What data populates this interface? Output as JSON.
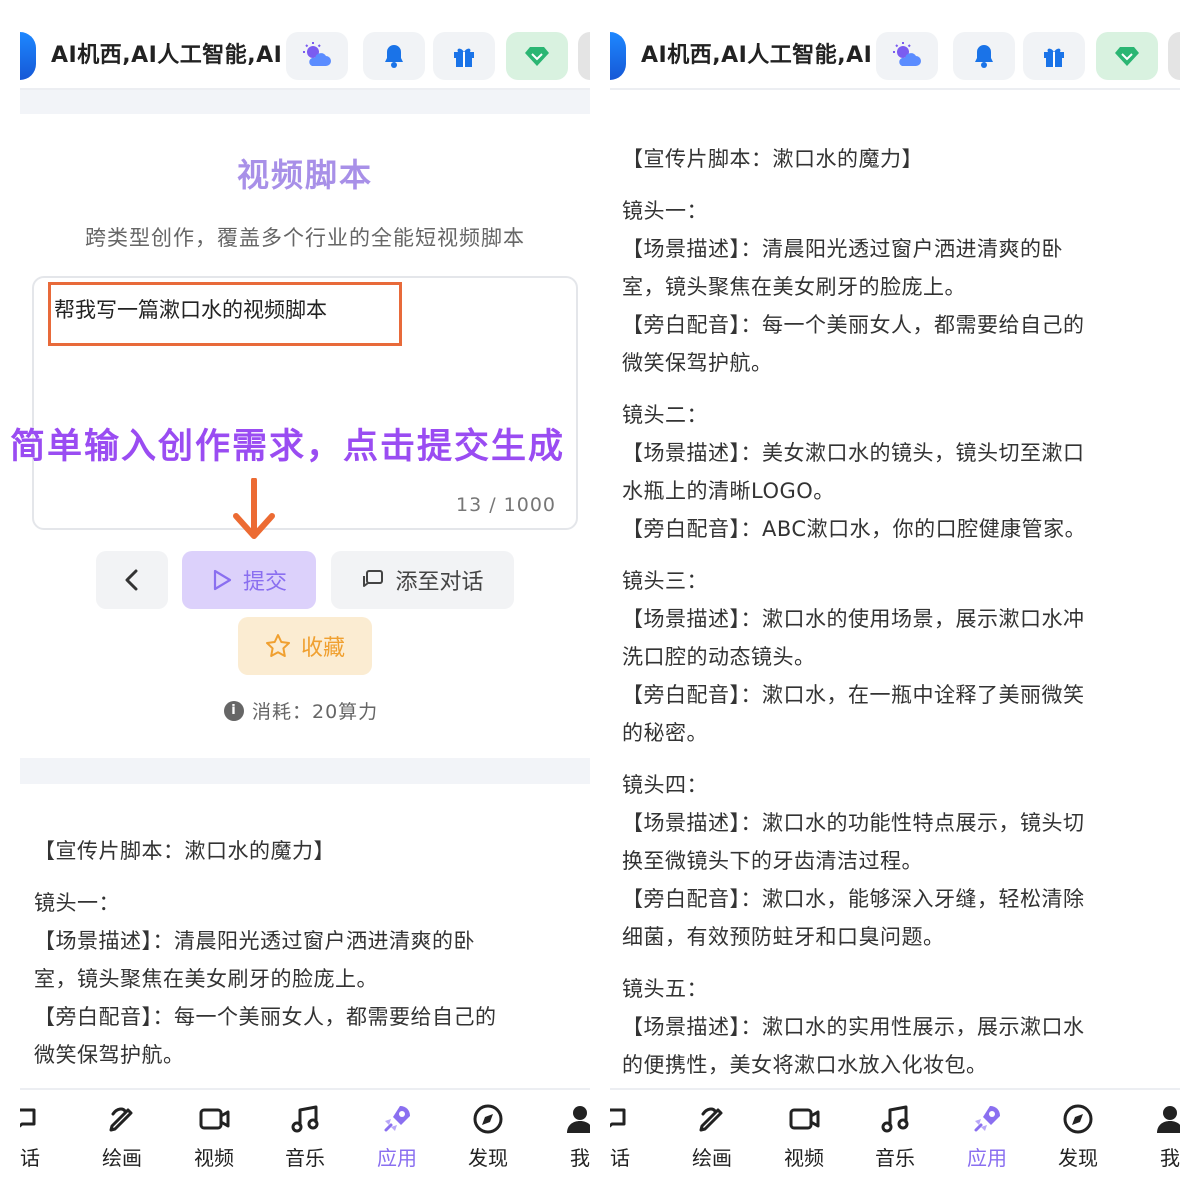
{
  "header": {
    "app_title": "AI机西,AI人工智能,AI",
    "icons": [
      "weather-icon",
      "bell-icon",
      "gift-icon",
      "diamond-vip-icon"
    ]
  },
  "form": {
    "title": "视频脚本",
    "subtitle": "跨类型创作，覆盖多个行业的全能短视频脚本",
    "prompt_value": "帮我写一篇漱口水的视频脚本",
    "char_count": "13 / 1000",
    "annotation": "简单输入创作需求，点击提交生成",
    "back_label": "<",
    "submit_label": "提交",
    "add_label": "添至对话",
    "favorite_label": "收藏",
    "cost_text": "消耗：20算力"
  },
  "script_left": [
    "【宣传片脚本：漱口水的魔力】",
    "镜头一：",
    "【场景描述】：清晨阳光透过窗户洒进清爽的卧",
    "室，镜头聚焦在美女刷牙的脸庞上。",
    "【旁白配音】：每一个美丽女人，都需要给自己的",
    "微笑保驾护航。"
  ],
  "script_right": [
    "【宣传片脚本：漱口水的魔力】",
    "镜头一：",
    "【场景描述】：清晨阳光透过窗户洒进清爽的卧",
    "室，镜头聚焦在美女刷牙的脸庞上。",
    "【旁白配音】：每一个美丽女人，都需要给自己的",
    "微笑保驾护航。",
    "镜头二：",
    "【场景描述】：美女漱口水的镜头，镜头切至漱口",
    "水瓶上的清晰LOGO。",
    "【旁白配音】：ABC漱口水，你的口腔健康管家。",
    "镜头三：",
    "【场景描述】：漱口水的使用场景，展示漱口水冲",
    "洗口腔的动态镜头。",
    "【旁白配音】：漱口水，在一瓶中诠释了美丽微笑",
    "的秘密。",
    "镜头四：",
    "【场景描述】：漱口水的功能性特点展示，镜头切",
    "换至微镜头下的牙齿清洁过程。",
    "【旁白配音】：漱口水，能够深入牙缝，轻松清除",
    "细菌，有效预防蛀牙和口臭问题。",
    "镜头五：",
    "【场景描述】：漱口水的实用性展示，展示漱口水",
    "的便携性，美女将漱口水放入化妆包。"
  ],
  "nav": {
    "items": [
      "对话",
      "绘画",
      "视频",
      "音乐",
      "应用",
      "发现",
      "我"
    ],
    "visible_labels": [
      "话",
      "绘画",
      "视频",
      "音乐",
      "应用",
      "发现",
      "我"
    ],
    "active": "应用"
  },
  "colors": {
    "accent_purple": "#8a6ff0",
    "annotation_purple": "#9a4cf2",
    "highlight_orange": "#e86a3a",
    "favorite_orange": "#f0a030",
    "logo_blue": "#1e88ff"
  }
}
